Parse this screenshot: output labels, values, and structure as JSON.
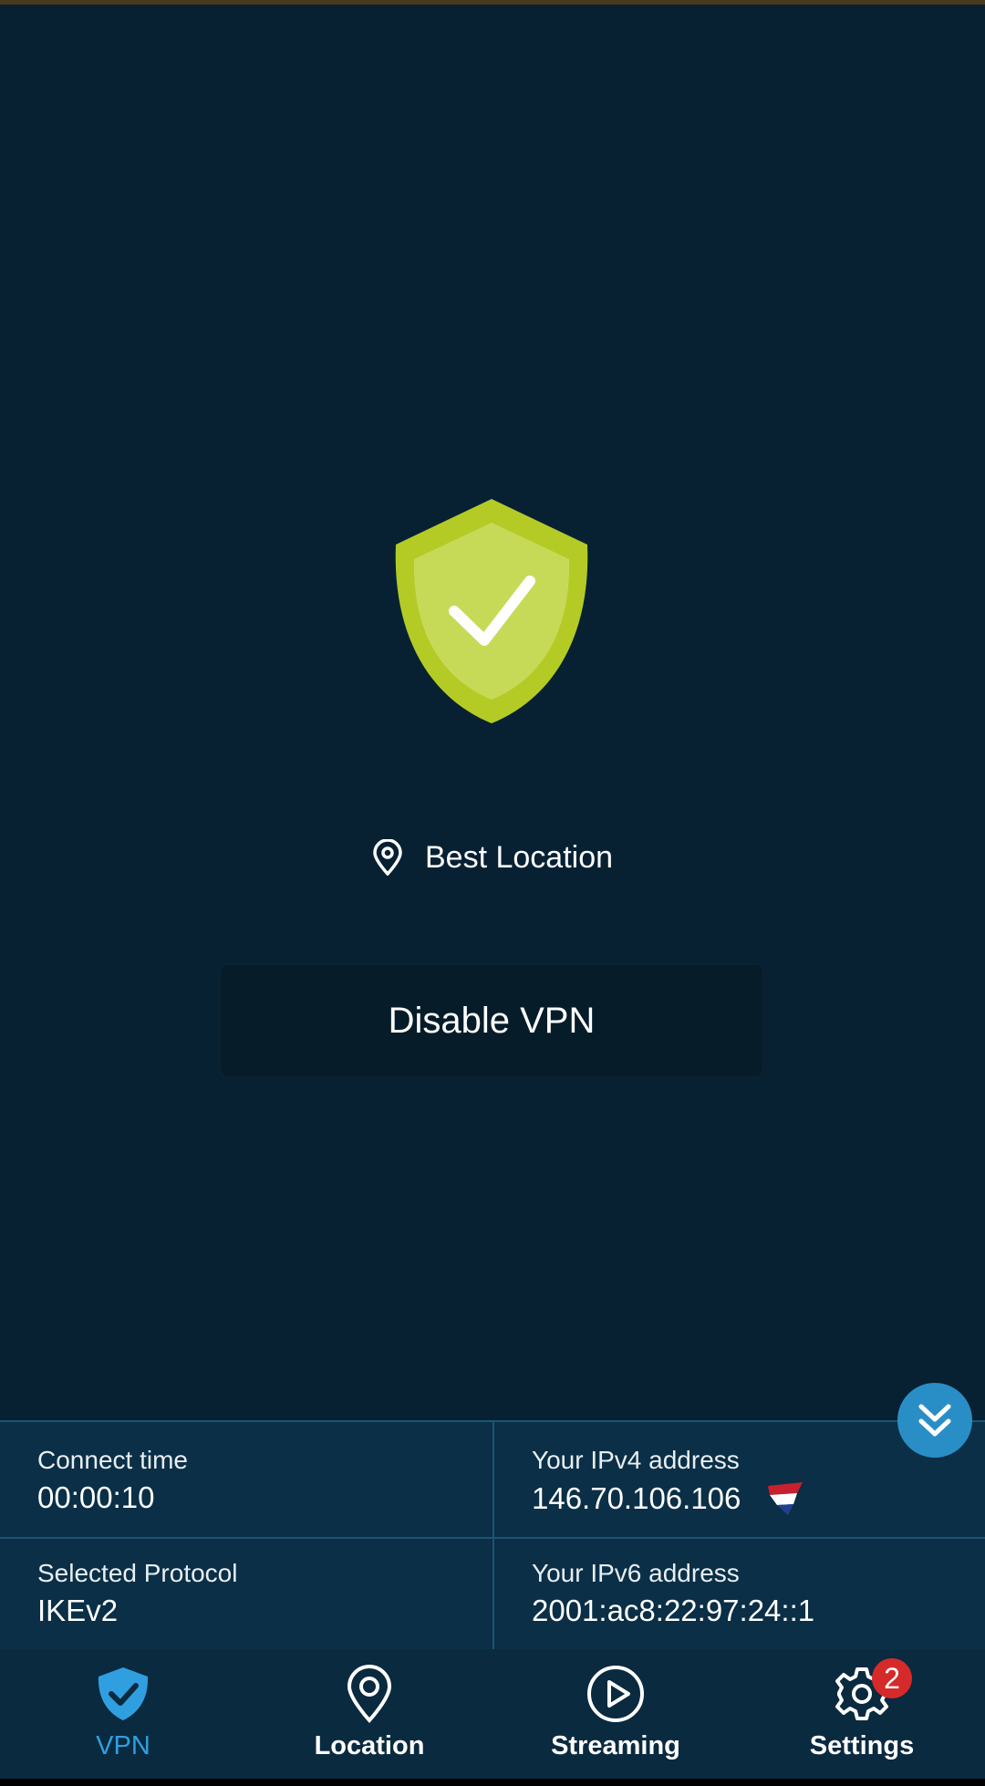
{
  "status": {
    "location_label": "Best Location",
    "disable_button": "Disable VPN"
  },
  "info": {
    "connect_time_label": "Connect time",
    "connect_time_value": "00:00:10",
    "ipv4_label": "Your IPv4 address",
    "ipv4_value": "146.70.106.106",
    "protocol_label": "Selected Protocol",
    "protocol_value": "IKEv2",
    "ipv6_label": "Your IPv6 address",
    "ipv6_value": "2001:ac8:22:97:24::1"
  },
  "nav": {
    "items": [
      {
        "label": "VPN",
        "icon": "shield-check-icon"
      },
      {
        "label": "Location",
        "icon": "map-pin-icon"
      },
      {
        "label": "Streaming",
        "icon": "play-circle-icon"
      },
      {
        "label": "Settings",
        "icon": "gear-icon"
      }
    ],
    "settings_badge": "2"
  },
  "colors": {
    "background": "#072133",
    "shield": "#b6cd2c",
    "accent": "#2f9fe0",
    "badge": "#d62a2a"
  }
}
